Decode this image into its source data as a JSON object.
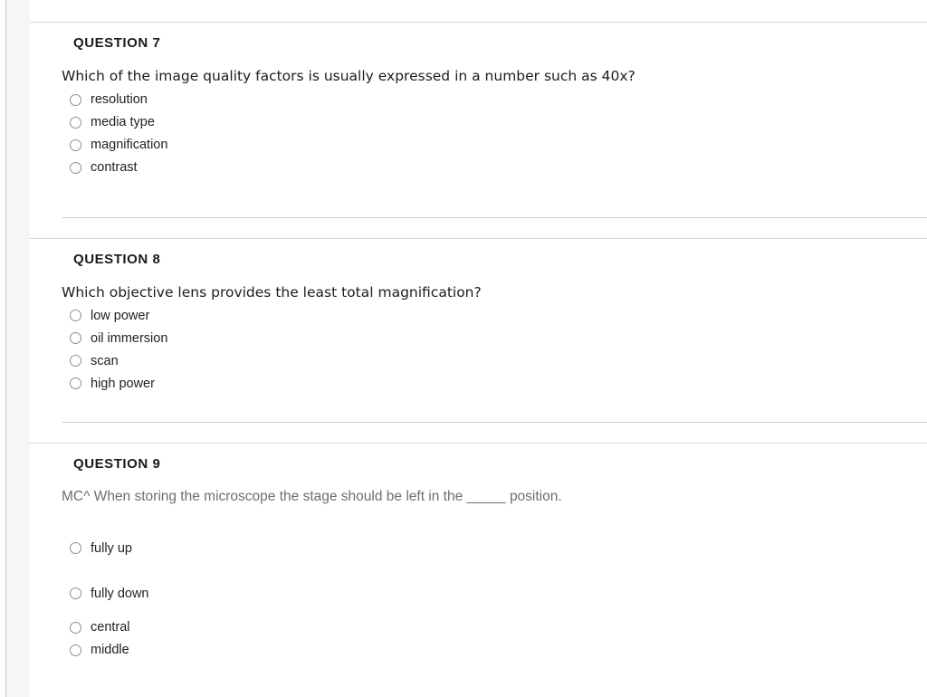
{
  "quiz": {
    "questions": [
      {
        "header": "QUESTION 7",
        "text": "Which of the image quality factors is usually expressed in a number such as 40x?",
        "text_style": "dark",
        "spacing": "compact",
        "options": [
          {
            "label": "resolution",
            "selected": false
          },
          {
            "label": "media type",
            "selected": false
          },
          {
            "label": "magnification",
            "selected": false
          },
          {
            "label": "contrast",
            "selected": false
          }
        ]
      },
      {
        "header": "QUESTION 8",
        "text": "Which objective lens provides the least total magnification?",
        "text_style": "dark",
        "spacing": "compact",
        "options": [
          {
            "label": "low power",
            "selected": false
          },
          {
            "label": "oil immersion",
            "selected": false
          },
          {
            "label": "scan",
            "selected": false
          },
          {
            "label": "high power",
            "selected": false
          }
        ]
      },
      {
        "header": "QUESTION 9",
        "text": "MC^ When storing the microscope the stage should be left in the _____ position.",
        "text_style": "muted",
        "spacing": "loose",
        "options": [
          {
            "label": "fully up",
            "selected": false
          },
          {
            "label": "fully down",
            "selected": false
          },
          {
            "label": "central",
            "selected": false
          },
          {
            "label": "middle",
            "selected": false
          }
        ]
      }
    ]
  },
  "colors": {
    "divider": "#d6d6d6",
    "inner_divider": "#d2d2d2",
    "gutter": "#f6f6f6",
    "left_rule": "#c9c9c9",
    "question_text_dark": "#1d1d1d",
    "question_text_muted": "#6e6e6e",
    "radio_border": "#8e8e8e",
    "page_background": "#ffffff"
  }
}
